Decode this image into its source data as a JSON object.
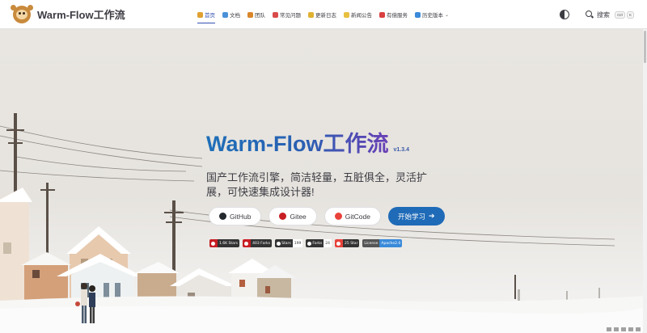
{
  "brand": {
    "name": "Warm-Flow工作流",
    "logo": "monkey-logo"
  },
  "nav": {
    "items": [
      {
        "label": "首页",
        "icon": "home-icon",
        "color": "#e0a030",
        "active": true
      },
      {
        "label": "文档",
        "icon": "doc-icon",
        "color": "#4a90d9",
        "active": false
      },
      {
        "label": "团队",
        "icon": "team-icon",
        "color": "#d9862a",
        "active": false
      },
      {
        "label": "常见问题",
        "icon": "question-icon",
        "color": "#d94a4a",
        "active": false
      },
      {
        "label": "更新日志",
        "icon": "log-icon",
        "color": "#e0b030",
        "active": false
      },
      {
        "label": "新闻公告",
        "icon": "news-icon",
        "color": "#e8c040",
        "active": false
      },
      {
        "label": "有偿服务",
        "icon": "service-icon",
        "color": "#d94040",
        "active": false
      },
      {
        "label": "历史版本",
        "icon": "history-icon",
        "color": "#3a8ad9",
        "active": false
      }
    ],
    "search_label": "搜索",
    "search_key1": "Ctrl",
    "search_key2": "K"
  },
  "hero": {
    "title": "Warm-Flow工作流",
    "version": "v1.3.4",
    "tagline": "国产工作流引擎，简洁轻量，五脏俱全，灵活扩展，可快速集成设计器!"
  },
  "actions": [
    {
      "label": "GitHub",
      "icon": "github-icon",
      "color": "#24292e"
    },
    {
      "label": "Gitee",
      "icon": "gitee-icon",
      "color": "#c71d23"
    },
    {
      "label": "GitCode",
      "icon": "gitcode-icon",
      "color": "#e8423a"
    },
    {
      "label": "开始学习",
      "icon": "arrow-right-icon",
      "color": "#1f6bb8"
    }
  ],
  "badges": [
    {
      "left": "1.6K Stars",
      "right": "",
      "leftColor": "#c71d23",
      "rightColor": "#333333"
    },
    {
      "left": "403 Forks",
      "right": "",
      "leftColor": "#c71d23",
      "rightColor": "#333333"
    },
    {
      "left": "Stars",
      "right": "199",
      "leftColor": "#333333",
      "rightColor": "#ffffff"
    },
    {
      "left": "Forks",
      "right": "24",
      "leftColor": "#333333",
      "rightColor": "#ffffff"
    },
    {
      "left": "25 Star",
      "right": "",
      "leftColor": "#e8423a",
      "rightColor": "#333333"
    },
    {
      "left": "License",
      "right": "Apache2.0",
      "leftColor": "#555555",
      "rightColor": "#3a8ad9"
    }
  ]
}
